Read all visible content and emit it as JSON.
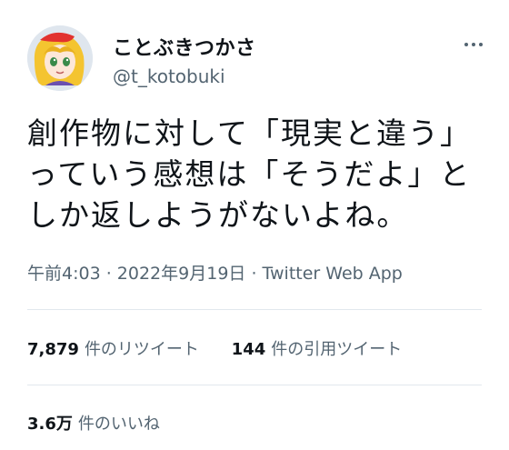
{
  "user": {
    "display_name": "ことぶきつかさ",
    "handle": "@t_kotobuki",
    "avatar_icon": "anime-character-avatar"
  },
  "more_icon": "ellipsis-icon",
  "tweet": {
    "text": "創作物に対して「現実と違う」\nっていう感想は「そうだよ」と\nしか返しようがないよね。",
    "time": "午前4:03",
    "date": "2022年9月19日",
    "source": "Twitter Web App"
  },
  "stats": {
    "retweets_count": "7,879",
    "retweets_label": "件のリツイート",
    "quotes_count": "144",
    "quotes_label": "件の引用ツイート",
    "likes_count": "3.6万",
    "likes_label": "件のいいね"
  },
  "colors": {
    "text": "#0f1419",
    "secondary": "#536471",
    "divider": "#e1e8ed",
    "avatar_hair": "#f4c430",
    "avatar_ribbon": "#e2322f"
  }
}
